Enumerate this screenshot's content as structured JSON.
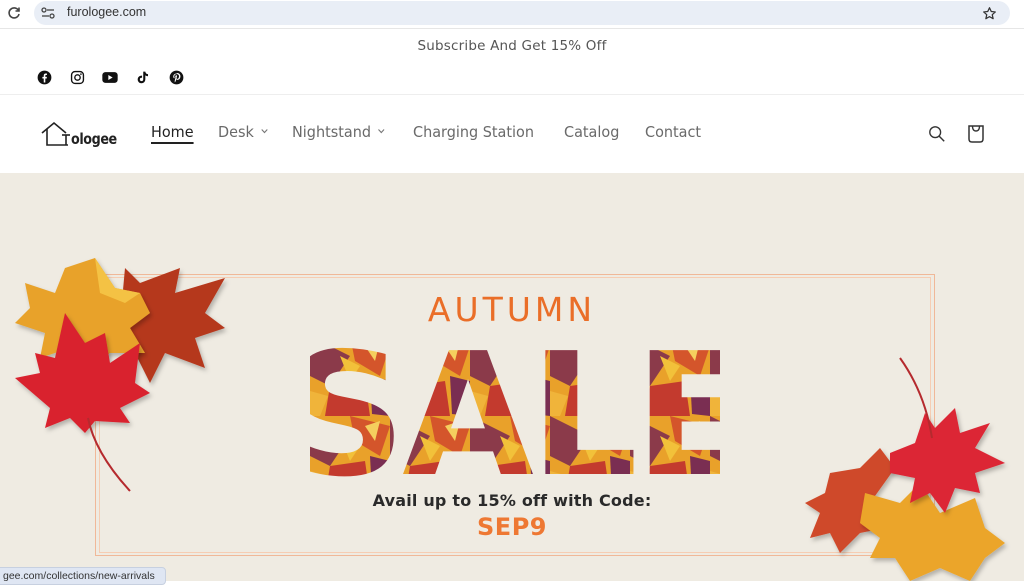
{
  "browser": {
    "url": "furologee.com",
    "status_link": "gee.com/collections/new-arrivals",
    "icons": [
      "reload-icon",
      "site-settings-icon",
      "bookmark-star-icon"
    ]
  },
  "announcement": {
    "text": "Subscribe And Get 15% Off"
  },
  "social": [
    {
      "name": "facebook",
      "icon": "facebook-icon"
    },
    {
      "name": "instagram",
      "icon": "instagram-icon"
    },
    {
      "name": "youtube",
      "icon": "youtube-icon"
    },
    {
      "name": "tiktok",
      "icon": "tiktok-icon"
    },
    {
      "name": "pinterest",
      "icon": "pinterest-icon"
    }
  ],
  "header": {
    "logo_text": "ologee",
    "nav": [
      {
        "label": "Home",
        "active": true,
        "dropdown": false
      },
      {
        "label": "Desk",
        "active": false,
        "dropdown": true
      },
      {
        "label": "Nightstand",
        "active": false,
        "dropdown": true
      },
      {
        "label": "Charging Station",
        "active": false,
        "dropdown": false
      },
      {
        "label": "Catalog",
        "active": false,
        "dropdown": false
      },
      {
        "label": "Contact",
        "active": false,
        "dropdown": false
      }
    ],
    "icons": [
      "search-icon",
      "cart-icon"
    ]
  },
  "hero": {
    "kicker": "AUTUMN",
    "headline": "SALE",
    "subtext": "Avail up to 15% off with Code:",
    "code": "SEP9",
    "colors": {
      "background": "#efebe2",
      "accent": "#ea6e28",
      "frame": "#f0b898",
      "text": "#2a2a2a"
    }
  }
}
